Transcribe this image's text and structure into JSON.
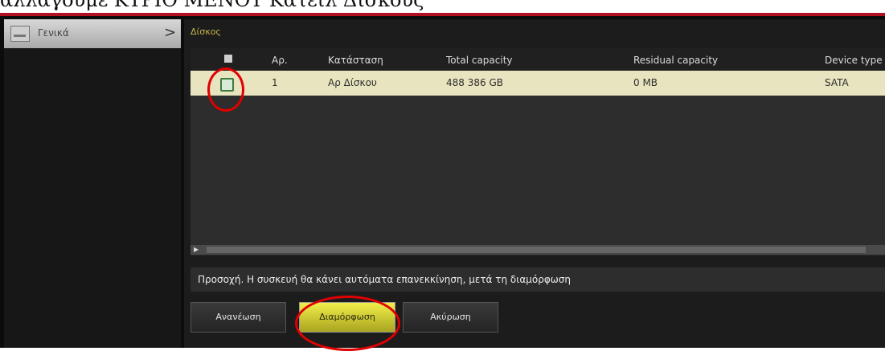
{
  "caption": "αλλαγούμε ΚΥΡΙΟ ΜΕΝΟΥ Κατειλ Δίσκους",
  "sidebar": {
    "item_label": "Γενικά",
    "chevron": ">"
  },
  "main": {
    "section_title": "Δίσκος",
    "table": {
      "headers": [
        "Αρ.",
        "Κατάσταση",
        "Total capacity",
        "Residual capacity",
        "Device type"
      ],
      "rows": [
        {
          "number": "1",
          "status": "Αρ Δίσκου",
          "total": "488 386 GB",
          "residual": "0 MB",
          "device": "SATA"
        }
      ]
    },
    "warning": "Προσοχή. Η συσκευή θα κάνει αυτόματα επανεκκίνηση, μετά τη διαμόρφωση",
    "buttons": {
      "refresh": "Ανανέωση",
      "format": "Διαμόρφωση",
      "cancel": "Ακύρωση"
    }
  },
  "colors": {
    "annotation": "#e00000",
    "selected_row": "#e8e4bf",
    "primary_button": "#f1ef4b"
  },
  "icons": {
    "sidebar": "disk-icon",
    "scroll_left": "scroll-left-icon",
    "header_checkbox": "checkbox-icon",
    "row_checkbox": "checked-checkbox-icon"
  }
}
